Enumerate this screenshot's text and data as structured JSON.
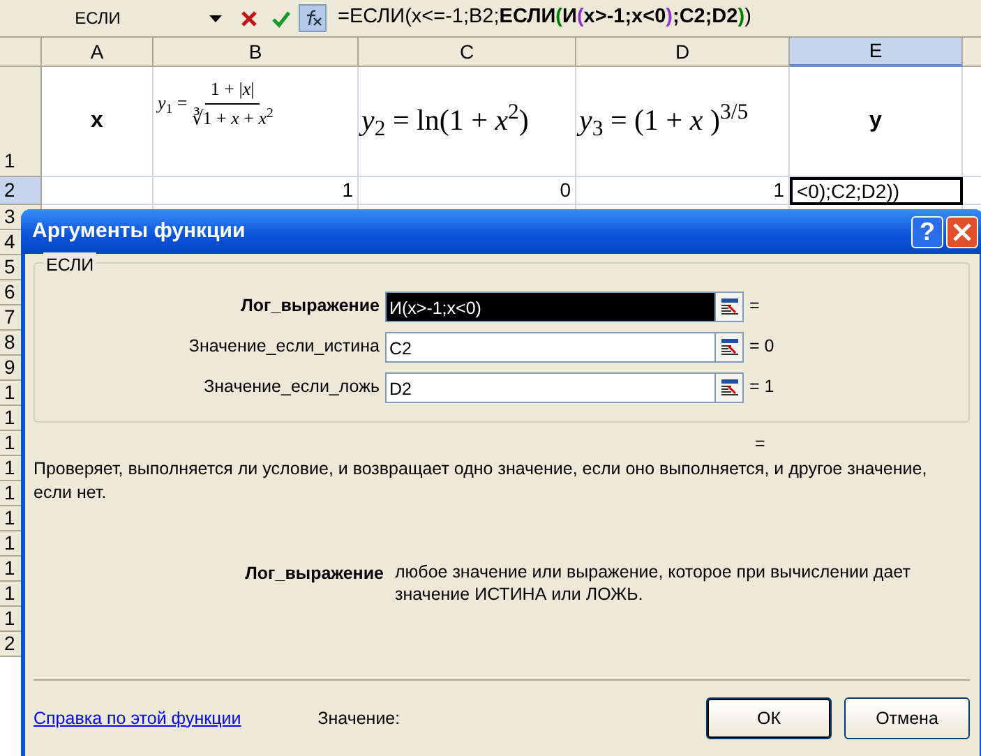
{
  "formula_bar": {
    "name_box": "ЕСЛИ",
    "formula": [
      {
        "text": "=ЕСЛИ(x<=-1;B2;",
        "bold": false,
        "color": "#000000"
      },
      {
        "text": "ЕСЛИ",
        "bold": true,
        "color": "#000000"
      },
      {
        "text": "(",
        "bold": true,
        "color": "#008000"
      },
      {
        "text": "И",
        "bold": true,
        "color": "#000000"
      },
      {
        "text": "(",
        "bold": true,
        "color": "#9933cc"
      },
      {
        "text": "x>-1;x<0",
        "bold": true,
        "color": "#000000"
      },
      {
        "text": ")",
        "bold": true,
        "color": "#9933cc"
      },
      {
        "text": ";C2;D2",
        "bold": true,
        "color": "#000000"
      },
      {
        "text": ")",
        "bold": true,
        "color": "#008000"
      },
      {
        "text": ")",
        "bold": false,
        "color": "#000000"
      }
    ]
  },
  "columns": [
    {
      "label": "A",
      "selected": false
    },
    {
      "label": "B",
      "selected": false
    },
    {
      "label": "C",
      "selected": false
    },
    {
      "label": "D",
      "selected": false
    },
    {
      "label": "E",
      "selected": true
    }
  ],
  "rows": [
    {
      "number": "1",
      "selected": false,
      "cells": [
        {
          "kind": "header",
          "text": "x"
        },
        {
          "kind": "fraction",
          "lhs": "*y*$_{1}$ =",
          "numerator": "1 + |*x*|",
          "denominator": "∛1 + *x* + *x*$^{2}$"
        },
        {
          "kind": "formula",
          "text": "*y*$_{2}$ = ln(1 + *x*$^{2}$)"
        },
        {
          "kind": "formula",
          "text": "*y*$_{3}$  =  (1 +  *x* )$^{3/5}$"
        },
        {
          "kind": "header",
          "text": "y"
        }
      ]
    },
    {
      "number": "2",
      "selected": true,
      "cells": [
        {
          "kind": "empty"
        },
        {
          "kind": "number",
          "text": "1"
        },
        {
          "kind": "number",
          "text": "0"
        },
        {
          "kind": "number",
          "text": "1"
        },
        {
          "kind": "editing",
          "text": "<0);C2;D2))"
        }
      ]
    },
    {
      "number": "3",
      "selected": false
    },
    {
      "number": "4",
      "selected": false
    },
    {
      "number": "5",
      "selected": false
    },
    {
      "number": "6",
      "selected": false
    },
    {
      "number": "7",
      "selected": false
    },
    {
      "number": "8",
      "selected": false
    },
    {
      "number": "9",
      "selected": false
    },
    {
      "number": "1",
      "selected": false
    },
    {
      "number": "1",
      "selected": false
    },
    {
      "number": "1",
      "selected": false
    },
    {
      "number": "1",
      "selected": false
    },
    {
      "number": "1",
      "selected": false
    },
    {
      "number": "1",
      "selected": false
    },
    {
      "number": "1",
      "selected": false
    },
    {
      "number": "1",
      "selected": false
    },
    {
      "number": "1",
      "selected": false
    },
    {
      "number": "1",
      "selected": false
    },
    {
      "number": "2",
      "selected": false
    }
  ],
  "dialog": {
    "title": "Аргументы функции",
    "help_button": "?",
    "function_name": "ЕСЛИ",
    "arguments": [
      {
        "label": "Лог_выражение",
        "value": "И(x>-1;x<0)",
        "result": "=",
        "focused": true
      },
      {
        "label": "Значение_если_истина",
        "value": "C2",
        "result": "= 0",
        "focused": false
      },
      {
        "label": "Значение_если_ложь",
        "value": "D2",
        "result": "= 1",
        "focused": false
      }
    ],
    "result": "=",
    "description": "Проверяет, выполняется ли условие, и возвращает одно значение, если оно выполняется, и другое значение, если нет.",
    "argument_help": {
      "label": "Лог_выражение",
      "text": "любое значение или выражение, которое при вычислении дает значение ИСТИНА или ЛОЖЬ."
    },
    "help_link": "Справка по этой функции",
    "value_label": "Значение:",
    "buttons": [
      {
        "label": "ОК",
        "default": true
      },
      {
        "label": "Отмена",
        "default": false
      }
    ]
  }
}
